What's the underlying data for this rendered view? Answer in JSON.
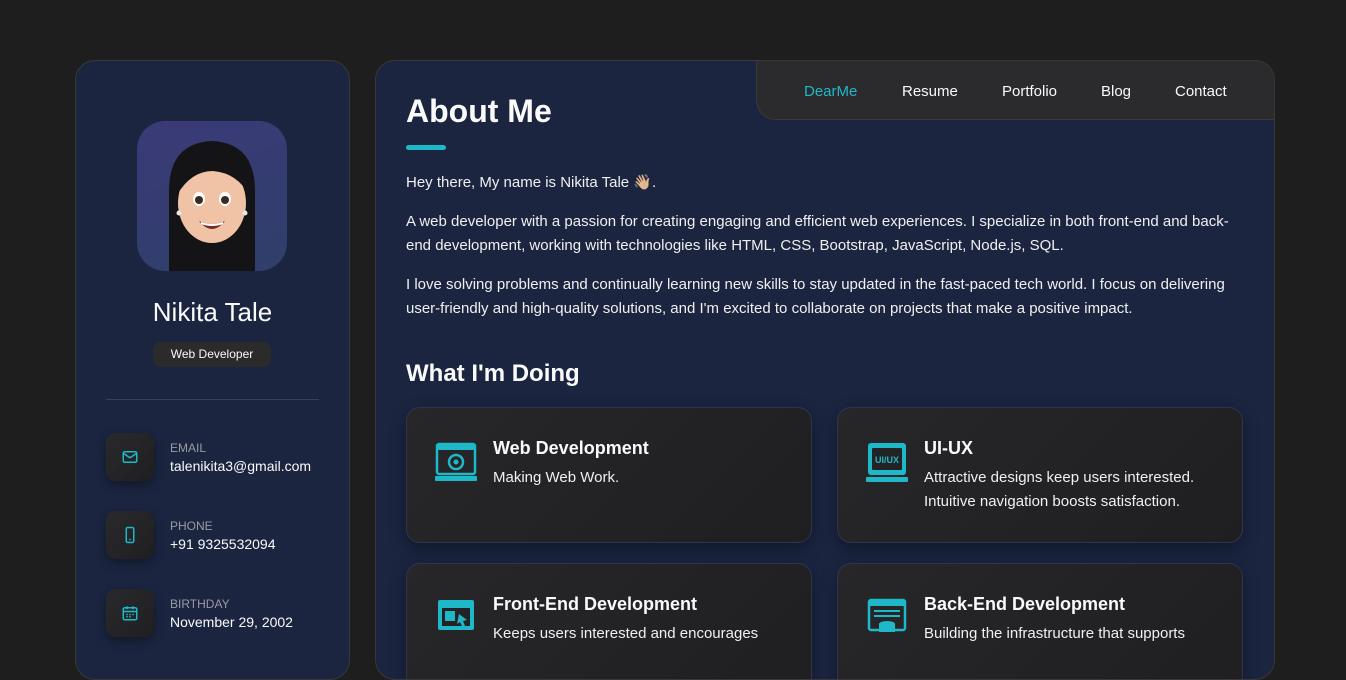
{
  "sidebar": {
    "name": "Nikita Tale",
    "title": "Web Developer",
    "contacts": [
      {
        "label": "Email",
        "value": "talenikita3@gmail.com",
        "icon": "mail-icon"
      },
      {
        "label": "Phone",
        "value": "+91 9325532094",
        "icon": "phone-icon"
      },
      {
        "label": "Birthday",
        "value": "November 29, 2002",
        "icon": "calendar-icon"
      }
    ]
  },
  "nav": {
    "items": [
      "DearMe",
      "Resume",
      "Portfolio",
      "Blog",
      "Contact"
    ],
    "active": "DearMe"
  },
  "about": {
    "title": "About Me",
    "paragraphs": [
      "Hey there, My name is Nikita Tale 👋🏼.",
      "A web developer with a passion for creating engaging and efficient web experiences. I specialize in both front-end and back-end development, working with technologies like HTML, CSS, Bootstrap, JavaScript, Node.js, SQL.",
      "I love solving problems and continually learning new skills to stay updated in the fast-paced tech world. I focus on delivering user-friendly and high-quality solutions, and I'm excited to collaborate on projects that make a positive impact."
    ]
  },
  "services": {
    "title": "What I'm Doing",
    "items": [
      {
        "title": "Web Development",
        "desc": "Making Web Work.",
        "icon": "web-development-icon"
      },
      {
        "title": "UI-UX",
        "desc": "Attractive designs keep users interested. Intuitive navigation boosts satisfaction.",
        "icon": "ui-ux-icon"
      },
      {
        "title": "Front-End Development",
        "desc": "Keeps users interested and encourages",
        "icon": "front-end-icon"
      },
      {
        "title": "Back-End Development",
        "desc": "Building the infrastructure that supports",
        "icon": "back-end-icon"
      }
    ]
  },
  "colors": {
    "accent": "#1fb8c9",
    "page_background": "#1e1e1f",
    "panel_background": "#1b2540"
  }
}
